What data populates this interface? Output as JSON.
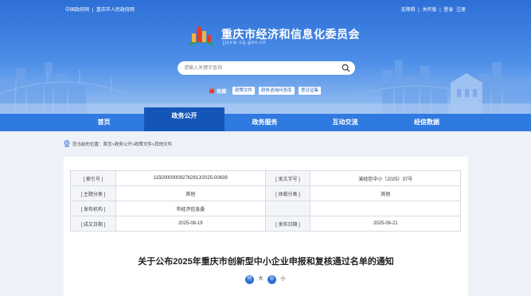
{
  "topbar": {
    "left_links": [
      "中国政府网",
      "重庆市人民政府网"
    ],
    "separator": "|",
    "right_links": [
      "无障碍",
      "关怀版",
      "登录",
      "注册"
    ]
  },
  "header": {
    "title": "重庆市经济和信息化委员会",
    "domain": "jjxxw.cq.gov.cn"
  },
  "search": {
    "placeholder": "请输入关键字查询"
  },
  "hotwords": {
    "label": "热搜:",
    "items": [
      "政策文件",
      "政务咨询问答库",
      "意见征集"
    ]
  },
  "nav": {
    "items": [
      {
        "label": "首页",
        "active": false
      },
      {
        "label": "政务公开",
        "active": true
      },
      {
        "label": "政务服务",
        "active": false
      },
      {
        "label": "互动交流",
        "active": false
      },
      {
        "label": "经信数据",
        "active": false
      }
    ]
  },
  "breadcrumb": {
    "text": "您当前的位置：首页>政务公开>政策文件>其他文件"
  },
  "meta_table": {
    "rows": [
      [
        "[ 索引号 ]",
        "11500000009276281J/2025-00639",
        "[ 发文字号 ]",
        "渝经信中小〔2025〕37号"
      ],
      [
        "[ 主题分类 ]",
        "其他",
        "[ 体裁分类 ]",
        "其他"
      ],
      [
        "[ 发布机构 ]",
        "市经济信息委",
        "",
        ""
      ],
      [
        "[ 成文日期 ]",
        "2025-08-19",
        "[ 发布日期 ]",
        "2025-08-21"
      ]
    ]
  },
  "article": {
    "title": "关于公布2025年重庆市创新型中小企业申报和复核通过名单的通知"
  },
  "font_size": {
    "items": [
      "特",
      "大",
      "中",
      "小"
    ]
  },
  "colors": {
    "nav_bg": "#2f7ae0",
    "nav_active": "#1456b8",
    "hero_top": "#2d6fd6",
    "accent_red": "#e23b2e"
  }
}
